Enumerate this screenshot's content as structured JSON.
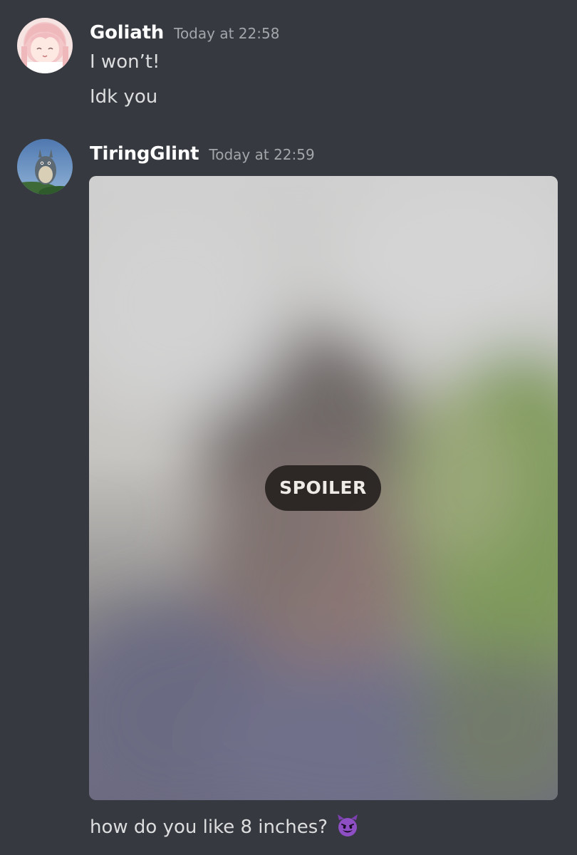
{
  "messages": [
    {
      "username": "Goliath",
      "timestamp": "Today at 22:58",
      "lines": [
        "I won’t!",
        "Idk you"
      ]
    },
    {
      "username": "TiringGlint",
      "timestamp": "Today at 22:59",
      "attachment": {
        "spoiler_label": "SPOILER"
      },
      "text": "how do you like 8 inches?",
      "emoji": "smiling-imp-emoji"
    }
  ],
  "colors": {
    "background": "#36393f",
    "username": "#ffffff",
    "timestamp": "#a3a6aa",
    "message_text": "#dcddde",
    "spoiler_badge": "#262220"
  }
}
